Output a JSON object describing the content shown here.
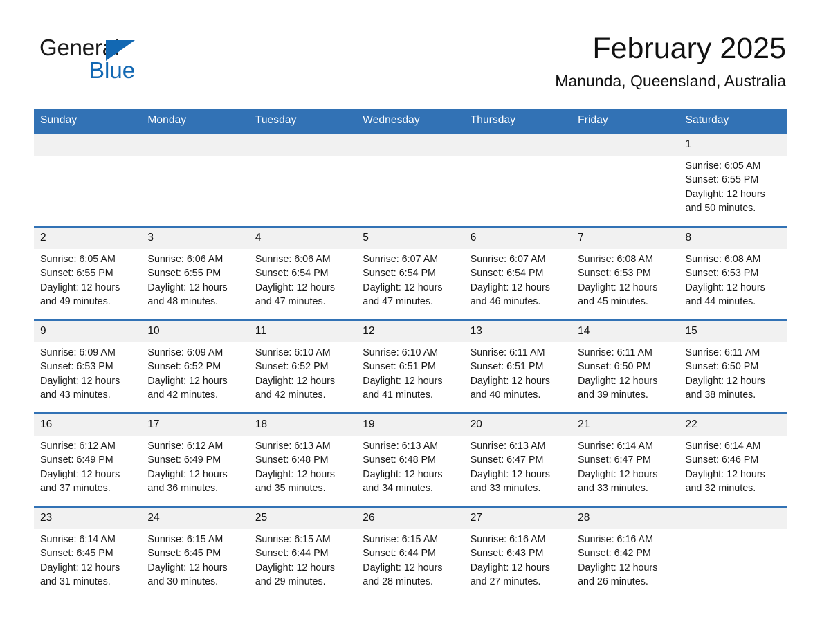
{
  "brand": {
    "name_part1": "General",
    "name_part2": "Blue",
    "logo_icon": "triangle-flag-icon",
    "accent_color": "#1268b3"
  },
  "header": {
    "month_title": "February 2025",
    "location": "Manunda, Queensland, Australia"
  },
  "calendar": {
    "header_color": "#3272b5",
    "daynum_band_color": "#f1f1f1",
    "weekday_headers": [
      "Sunday",
      "Monday",
      "Tuesday",
      "Wednesday",
      "Thursday",
      "Friday",
      "Saturday"
    ],
    "weeks": [
      [
        {
          "day": "",
          "blank": true
        },
        {
          "day": "",
          "blank": true
        },
        {
          "day": "",
          "blank": true
        },
        {
          "day": "",
          "blank": true
        },
        {
          "day": "",
          "blank": true
        },
        {
          "day": "",
          "blank": true
        },
        {
          "day": "1",
          "sunrise": "Sunrise: 6:05 AM",
          "sunset": "Sunset: 6:55 PM",
          "daylight": "Daylight: 12 hours and 50 minutes."
        }
      ],
      [
        {
          "day": "2",
          "sunrise": "Sunrise: 6:05 AM",
          "sunset": "Sunset: 6:55 PM",
          "daylight": "Daylight: 12 hours and 49 minutes."
        },
        {
          "day": "3",
          "sunrise": "Sunrise: 6:06 AM",
          "sunset": "Sunset: 6:55 PM",
          "daylight": "Daylight: 12 hours and 48 minutes."
        },
        {
          "day": "4",
          "sunrise": "Sunrise: 6:06 AM",
          "sunset": "Sunset: 6:54 PM",
          "daylight": "Daylight: 12 hours and 47 minutes."
        },
        {
          "day": "5",
          "sunrise": "Sunrise: 6:07 AM",
          "sunset": "Sunset: 6:54 PM",
          "daylight": "Daylight: 12 hours and 47 minutes."
        },
        {
          "day": "6",
          "sunrise": "Sunrise: 6:07 AM",
          "sunset": "Sunset: 6:54 PM",
          "daylight": "Daylight: 12 hours and 46 minutes."
        },
        {
          "day": "7",
          "sunrise": "Sunrise: 6:08 AM",
          "sunset": "Sunset: 6:53 PM",
          "daylight": "Daylight: 12 hours and 45 minutes."
        },
        {
          "day": "8",
          "sunrise": "Sunrise: 6:08 AM",
          "sunset": "Sunset: 6:53 PM",
          "daylight": "Daylight: 12 hours and 44 minutes."
        }
      ],
      [
        {
          "day": "9",
          "sunrise": "Sunrise: 6:09 AM",
          "sunset": "Sunset: 6:53 PM",
          "daylight": "Daylight: 12 hours and 43 minutes."
        },
        {
          "day": "10",
          "sunrise": "Sunrise: 6:09 AM",
          "sunset": "Sunset: 6:52 PM",
          "daylight": "Daylight: 12 hours and 42 minutes."
        },
        {
          "day": "11",
          "sunrise": "Sunrise: 6:10 AM",
          "sunset": "Sunset: 6:52 PM",
          "daylight": "Daylight: 12 hours and 42 minutes."
        },
        {
          "day": "12",
          "sunrise": "Sunrise: 6:10 AM",
          "sunset": "Sunset: 6:51 PM",
          "daylight": "Daylight: 12 hours and 41 minutes."
        },
        {
          "day": "13",
          "sunrise": "Sunrise: 6:11 AM",
          "sunset": "Sunset: 6:51 PM",
          "daylight": "Daylight: 12 hours and 40 minutes."
        },
        {
          "day": "14",
          "sunrise": "Sunrise: 6:11 AM",
          "sunset": "Sunset: 6:50 PM",
          "daylight": "Daylight: 12 hours and 39 minutes."
        },
        {
          "day": "15",
          "sunrise": "Sunrise: 6:11 AM",
          "sunset": "Sunset: 6:50 PM",
          "daylight": "Daylight: 12 hours and 38 minutes."
        }
      ],
      [
        {
          "day": "16",
          "sunrise": "Sunrise: 6:12 AM",
          "sunset": "Sunset: 6:49 PM",
          "daylight": "Daylight: 12 hours and 37 minutes."
        },
        {
          "day": "17",
          "sunrise": "Sunrise: 6:12 AM",
          "sunset": "Sunset: 6:49 PM",
          "daylight": "Daylight: 12 hours and 36 minutes."
        },
        {
          "day": "18",
          "sunrise": "Sunrise: 6:13 AM",
          "sunset": "Sunset: 6:48 PM",
          "daylight": "Daylight: 12 hours and 35 minutes."
        },
        {
          "day": "19",
          "sunrise": "Sunrise: 6:13 AM",
          "sunset": "Sunset: 6:48 PM",
          "daylight": "Daylight: 12 hours and 34 minutes."
        },
        {
          "day": "20",
          "sunrise": "Sunrise: 6:13 AM",
          "sunset": "Sunset: 6:47 PM",
          "daylight": "Daylight: 12 hours and 33 minutes."
        },
        {
          "day": "21",
          "sunrise": "Sunrise: 6:14 AM",
          "sunset": "Sunset: 6:47 PM",
          "daylight": "Daylight: 12 hours and 33 minutes."
        },
        {
          "day": "22",
          "sunrise": "Sunrise: 6:14 AM",
          "sunset": "Sunset: 6:46 PM",
          "daylight": "Daylight: 12 hours and 32 minutes."
        }
      ],
      [
        {
          "day": "23",
          "sunrise": "Sunrise: 6:14 AM",
          "sunset": "Sunset: 6:45 PM",
          "daylight": "Daylight: 12 hours and 31 minutes."
        },
        {
          "day": "24",
          "sunrise": "Sunrise: 6:15 AM",
          "sunset": "Sunset: 6:45 PM",
          "daylight": "Daylight: 12 hours and 30 minutes."
        },
        {
          "day": "25",
          "sunrise": "Sunrise: 6:15 AM",
          "sunset": "Sunset: 6:44 PM",
          "daylight": "Daylight: 12 hours and 29 minutes."
        },
        {
          "day": "26",
          "sunrise": "Sunrise: 6:15 AM",
          "sunset": "Sunset: 6:44 PM",
          "daylight": "Daylight: 12 hours and 28 minutes."
        },
        {
          "day": "27",
          "sunrise": "Sunrise: 6:16 AM",
          "sunset": "Sunset: 6:43 PM",
          "daylight": "Daylight: 12 hours and 27 minutes."
        },
        {
          "day": "28",
          "sunrise": "Sunrise: 6:16 AM",
          "sunset": "Sunset: 6:42 PM",
          "daylight": "Daylight: 12 hours and 26 minutes."
        },
        {
          "day": "",
          "blank": true
        }
      ]
    ]
  }
}
